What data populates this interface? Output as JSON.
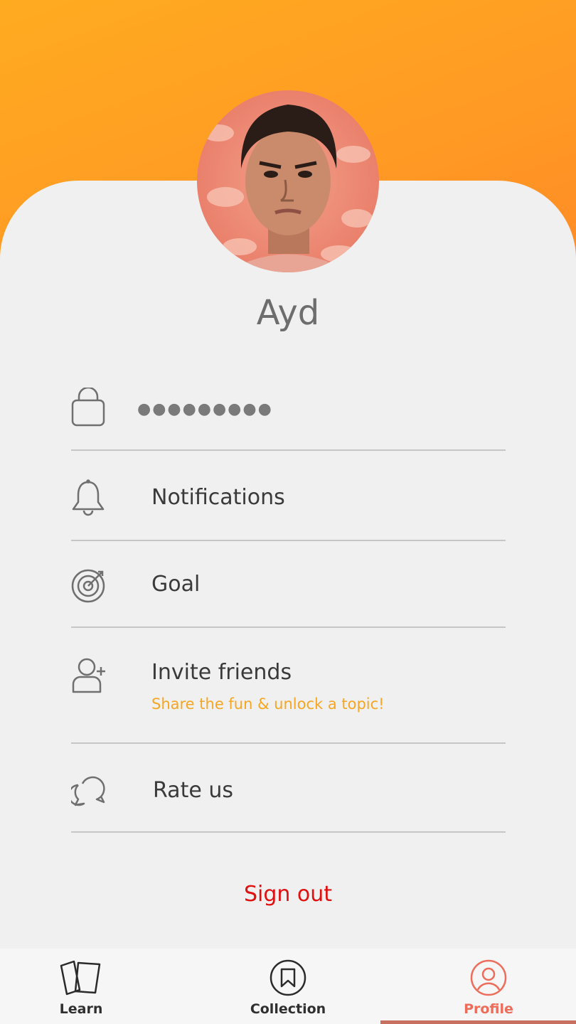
{
  "profile": {
    "name": "Ayd",
    "avatar_alt": "profile photo"
  },
  "settings": {
    "password_mask": "●●●●●●●●●",
    "items": [
      {
        "label": "Notifications",
        "icon": "bell-icon"
      },
      {
        "label": "Goal",
        "icon": "target-icon"
      },
      {
        "label": "Invite friends",
        "subtitle": "Share the fun & unlock a topic!",
        "icon": "add-user-icon"
      },
      {
        "label": "Rate us",
        "icon": "chat-bubbles-icon"
      }
    ]
  },
  "signout_label": "Sign out",
  "tabs": [
    {
      "label": "Learn",
      "icon": "cards-icon"
    },
    {
      "label": "Collection",
      "icon": "bookmark-icon"
    },
    {
      "label": "Profile",
      "icon": "user-icon",
      "active": true
    }
  ],
  "colors": {
    "header_gradient_start": "#ffab20",
    "header_gradient_end": "#ff8a26",
    "accent": "#f5a623",
    "signout": "#e01010",
    "active_tab": "#ee6c5a"
  }
}
